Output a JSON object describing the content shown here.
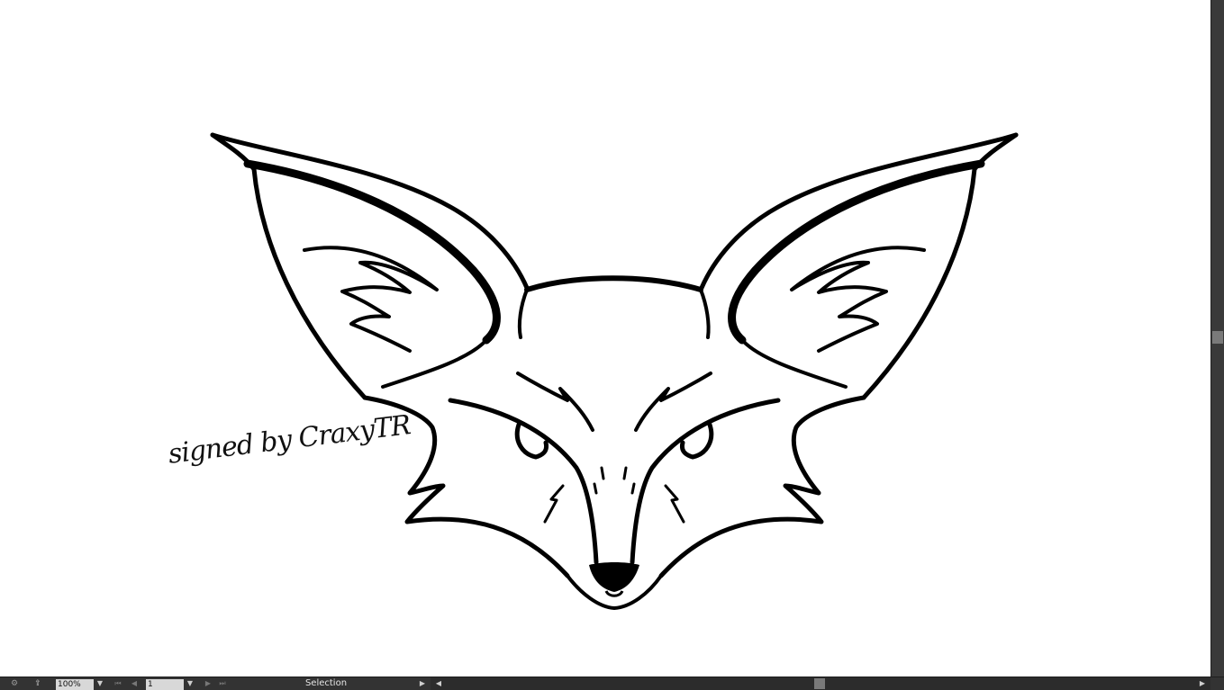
{
  "artwork": {
    "signature_text": "signed by CraxyTR"
  },
  "statusbar": {
    "zoom_value": "100%",
    "artboard_value": "1",
    "tool_label": "Selection"
  },
  "icons": {
    "gpu": "gpu-performance-icon",
    "share": "share-icon",
    "zoom_dropdown": "chevron-down-icon",
    "first": "first-artboard-icon",
    "prev": "previous-artboard-icon",
    "artboard_dropdown": "chevron-down-icon",
    "next": "next-artboard-icon",
    "last": "last-artboard-icon",
    "status_menu": "status-menu-arrow-icon",
    "scroll_left": "scroll-left-icon",
    "scroll_right": "scroll-right-icon"
  },
  "colors": {
    "ink": "#000000",
    "canvas": "#ffffff",
    "chrome_dark": "#333333",
    "scroll_thumb": "#7a7a7a"
  }
}
